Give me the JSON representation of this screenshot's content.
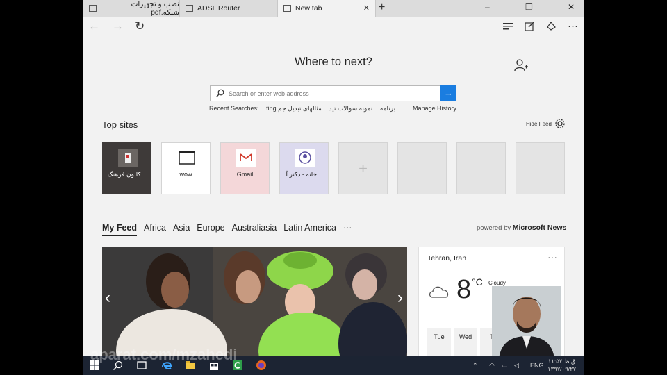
{
  "tabs": [
    {
      "label": "نصب و تجهیزات شبکه.pdf",
      "active": false
    },
    {
      "label": "ADSL Router",
      "active": false
    },
    {
      "label": "New tab",
      "active": true
    }
  ],
  "window_controls": {
    "minimize": "–",
    "restore": "❐",
    "close": "✕"
  },
  "new_tab_symbol": "+",
  "toolbar": {
    "back": "←",
    "forward": "→",
    "refresh": "↻",
    "more": "···"
  },
  "heading": "Where to next?",
  "search": {
    "placeholder": "Search or enter web address",
    "go": "→"
  },
  "recent": {
    "label": "Recent Searches:",
    "items": [
      "fing برنامه",
      "نمونه سوالات تید",
      "مثالهای تبدیل جم"
    ],
    "manage": "Manage History"
  },
  "top_sites": {
    "title": "Top sites",
    "hide_feed": "Hide Feed",
    "tiles": [
      {
        "label": "کانون فرهنگ..."
      },
      {
        "label": "wow"
      },
      {
        "label": "Gmail"
      },
      {
        "label": "خانه - دکتر آ..."
      },
      {
        "label": ""
      },
      {
        "label": ""
      },
      {
        "label": ""
      },
      {
        "label": ""
      }
    ]
  },
  "feed": {
    "categories": [
      "My Feed",
      "Africa",
      "Asia",
      "Europe",
      "Australiasia",
      "Latin America",
      "···"
    ],
    "powered_prefix": "powered by",
    "powered_brand": "Microsoft News"
  },
  "weather": {
    "location": "Tehran, Iran",
    "more": "···",
    "temp": "8",
    "unit": "°C",
    "condition": "Cloudy",
    "days": [
      "Tue",
      "Wed",
      "T"
    ]
  },
  "taskbar": {
    "lang": "ENG",
    "time": "۱۱:۵۷ ق.ظ",
    "date": "۱۳۹۷/۰۹/۲۷"
  },
  "watermark": "aparat.com/mzahedi",
  "colors": {
    "accent": "#1a7de0",
    "taskbar": "#1c2433"
  }
}
